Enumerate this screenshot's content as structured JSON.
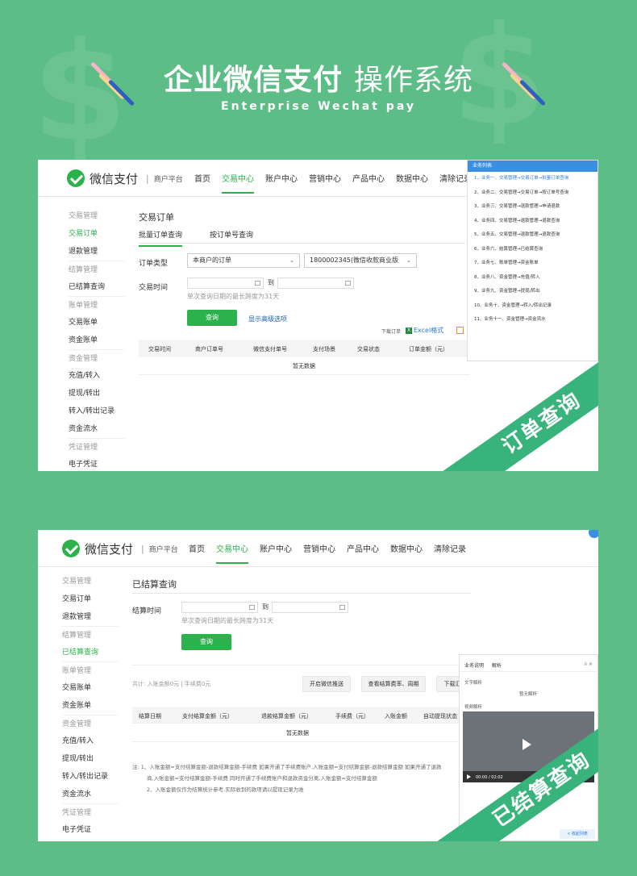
{
  "banner": {
    "title_bold": "企业微信支付",
    "title_light": "操作系统",
    "subtitle": "Enterprise Wechat pay"
  },
  "colors": {
    "brand_green": "#2bb24c",
    "background": "#5dbd86",
    "ribbon": "#39b37c",
    "link_blue": "#1a5fb4"
  },
  "panel1": {
    "logo_text": "微信支付",
    "logo_sub": "商户平台",
    "nav": [
      "首页",
      "交易中心",
      "账户中心",
      "营销中心",
      "产品中心",
      "数据中心",
      "清除记录"
    ],
    "nav_active_index": 1,
    "sidebar": [
      {
        "label": "交易管理",
        "type": "group"
      },
      {
        "label": "交易订单",
        "type": "item",
        "active": true
      },
      {
        "label": "退款管理",
        "type": "item"
      },
      {
        "label": "结算管理",
        "type": "group"
      },
      {
        "label": "已结算查询",
        "type": "item"
      },
      {
        "label": "账单管理",
        "type": "group"
      },
      {
        "label": "交易账单",
        "type": "item"
      },
      {
        "label": "资金账单",
        "type": "item"
      },
      {
        "label": "资金管理",
        "type": "group"
      },
      {
        "label": "充值/转入",
        "type": "item"
      },
      {
        "label": "提现/转出",
        "type": "item"
      },
      {
        "label": "转入/转出记录",
        "type": "item"
      },
      {
        "label": "资金流水",
        "type": "item"
      },
      {
        "label": "凭证管理",
        "type": "group"
      },
      {
        "label": "电子凭证",
        "type": "item"
      }
    ],
    "page_title": "交易订单",
    "tabs": [
      "批量订单查询",
      "按订单号查询"
    ],
    "order_type_label": "订单类型",
    "order_type_value": "本商户的订单",
    "merchant_value": "1800002345(微信收款商业版",
    "trade_time_label": "交易时间",
    "date_to": "到",
    "hint": "单次查询日期的最长跨度为31天",
    "query_button": "查询",
    "advanced_link": "显示高级选项",
    "download_label": "下载订单",
    "excel_label": "Excel格式",
    "table_headers": [
      "交易时间",
      "商户订单号",
      "微信支付单号",
      "支付场景",
      "交易状态",
      "订单金额（元）"
    ],
    "empty": "暂无数据",
    "popup_title": "业务列表",
    "popup_items": [
      "1、业务一、交易管理→交易订单→批量订单查询",
      "2、业务二、交易管理→交易订单→按订单号查询",
      "3、业务三、交易管理→退款管理→申请退款",
      "4、业务四、交易管理→退款管理→退款查询",
      "5、业务五、交易管理→退款管理→退款查询",
      "6、业务六、结算管理→已结算查询",
      "7、业务七、账单管理→资金账单",
      "8、业务八、资金管理→充值/转入",
      "9、业务九、资金管理→提现/转出",
      "10、业务十、资金管理→转入/转出记录",
      "11、业务十一、资金管理→资金流水"
    ],
    "ribbon": "订单查询"
  },
  "panel2": {
    "logo_text": "微信支付",
    "logo_sub": "商户平台",
    "nav": [
      "首页",
      "交易中心",
      "账户中心",
      "营销中心",
      "产品中心",
      "数据中心",
      "清除记录"
    ],
    "nav_active_index": 1,
    "sidebar": [
      {
        "label": "交易管理",
        "type": "group"
      },
      {
        "label": "交易订单",
        "type": "item"
      },
      {
        "label": "退款管理",
        "type": "item"
      },
      {
        "label": "结算管理",
        "type": "group"
      },
      {
        "label": "已结算查询",
        "type": "item",
        "active": true
      },
      {
        "label": "账单管理",
        "type": "group"
      },
      {
        "label": "交易账单",
        "type": "item"
      },
      {
        "label": "资金账单",
        "type": "item"
      },
      {
        "label": "资金管理",
        "type": "group"
      },
      {
        "label": "充值/转入",
        "type": "item"
      },
      {
        "label": "提现/转出",
        "type": "item"
      },
      {
        "label": "转入/转出记录",
        "type": "item"
      },
      {
        "label": "资金流水",
        "type": "item"
      },
      {
        "label": "凭证管理",
        "type": "group"
      },
      {
        "label": "电子凭证",
        "type": "item"
      }
    ],
    "page_title": "已结算查询",
    "settle_time_label": "结算时间",
    "date_to": "到",
    "hint": "单次查询日期的最长跨度为31天",
    "query_button": "查询",
    "summary": "共计: 入账金额0元 | 手续费0元",
    "btn_notify": "开启微信推送",
    "btn_fee": "查看结算费率、周期",
    "btn_download": "下载汇",
    "table_headers": [
      "结算日期",
      "支付结算金额（元）",
      "退款结算金额（元）",
      "手续费（元）",
      "入账金额",
      "自动提现状态"
    ],
    "empty": "暂无数据",
    "notes": [
      "注: 1、入账金额=支付结算金额-退款结算金额-手续费 如果开通了手续费账户,入账金额=支付结算金额-退款结算金额 如果开通了退款",
      "商,入账金额=支付结算金额-手续费 同时开通了手续费账户和退款资金分离,入账金额=支付结算金额",
      "2、入账金额仅作为结算统计参考,实际收到的款项请以提现记录为准"
    ],
    "video_tabs": [
      "业务说明",
      "解析"
    ],
    "video_text_label": "文字解析",
    "video_none": "暂无解析",
    "video_label": "视频解析",
    "video_time": "00:00 / 02:02",
    "footer_btn": "< 收起列表",
    "ribbon": "已结算查询"
  }
}
